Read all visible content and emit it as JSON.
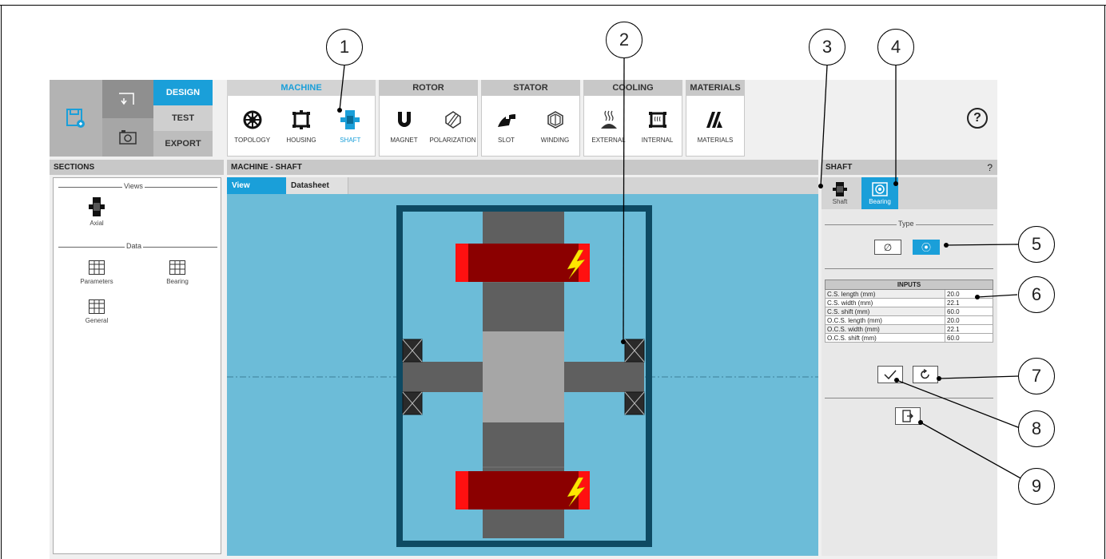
{
  "modes": {
    "design": "DESIGN",
    "test": "TEST",
    "export": "EXPORT"
  },
  "ribbon": {
    "machine": {
      "title": "MACHINE",
      "tools": [
        "TOPOLOGY",
        "HOUSING",
        "SHAFT"
      ]
    },
    "rotor": {
      "title": "ROTOR",
      "tools": [
        "MAGNET",
        "POLARIZATION"
      ]
    },
    "stator": {
      "title": "STATOR",
      "tools": [
        "SLOT",
        "WINDING"
      ]
    },
    "cooling": {
      "title": "COOLING",
      "tools": [
        "EXTERNAL",
        "INTERNAL"
      ]
    },
    "materials": {
      "title": "MATERIALS",
      "tools": [
        "MATERIALS"
      ]
    }
  },
  "help": "?",
  "sections": {
    "title": "SECTIONS",
    "views_label": "Views",
    "data_label": "Data",
    "axial": "Axial",
    "parameters": "Parameters",
    "bearing": "Bearing",
    "general": "General"
  },
  "center": {
    "title": "MACHINE - SHAFT",
    "tab_view": "View",
    "tab_datasheet": "Datasheet"
  },
  "right": {
    "title": "SHAFT",
    "help": "?",
    "tab_shaft": "Shaft",
    "tab_bearing": "Bearing",
    "type_label": "Type",
    "inputs_title": "INPUTS",
    "inputs": [
      {
        "label": "C.S. length (mm)",
        "value": "20.0"
      },
      {
        "label": "C.S. width (mm)",
        "value": "22.1"
      },
      {
        "label": "C.S. shift (mm)",
        "value": "60.0"
      },
      {
        "label": "O.C.S. length (mm)",
        "value": "20.0"
      },
      {
        "label": "O.C.S. width (mm)",
        "value": "22.1"
      },
      {
        "label": "O.C.S. shift (mm)",
        "value": "60.0"
      }
    ]
  },
  "callouts": [
    "1",
    "2",
    "3",
    "4",
    "5",
    "6",
    "7",
    "8",
    "9"
  ],
  "colors": {
    "accent": "#1a9fd9",
    "viewport": "#6cbcd8",
    "magnet": "#8b0000",
    "frame": "#0e4a63"
  }
}
